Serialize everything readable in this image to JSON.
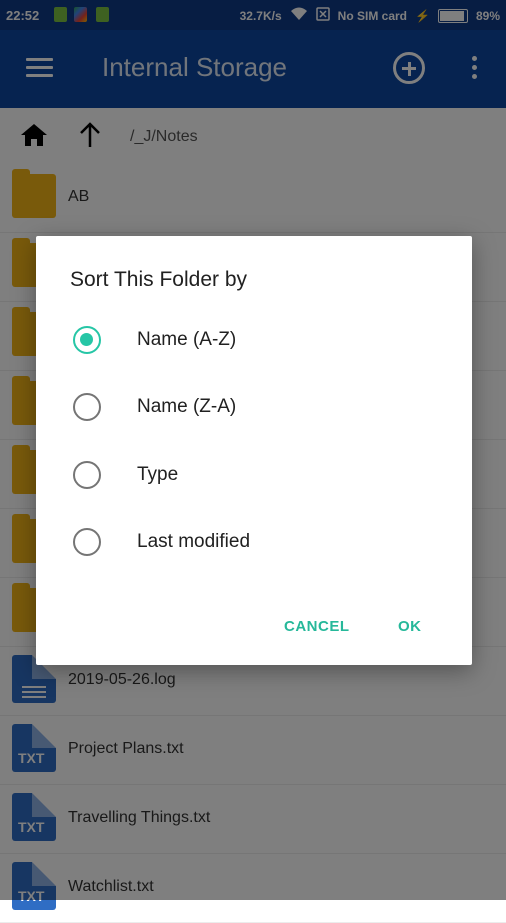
{
  "status_bar": {
    "time": "22:52",
    "speed": "32.7K/s",
    "sim": "No SIM card",
    "battery": "89%",
    "battery_level": 0.89
  },
  "app_bar": {
    "title": "Internal Storage"
  },
  "path_bar": {
    "path": "/_J/Notes"
  },
  "files": [
    {
      "name": "AB",
      "icon": "folder-icon"
    },
    {
      "name": "",
      "icon": "folder-icon"
    },
    {
      "name": "",
      "icon": "folder-icon"
    },
    {
      "name": "",
      "icon": "folder-icon"
    },
    {
      "name": "",
      "icon": "folder-icon"
    },
    {
      "name": "",
      "icon": "folder-icon"
    },
    {
      "name": "",
      "icon": "folder-icon"
    },
    {
      "name": "2019-05-26.log",
      "icon": "log-file-icon"
    },
    {
      "name": "Project Plans.txt",
      "icon": "txt-file-icon",
      "tag": "TXT"
    },
    {
      "name": "Travelling Things.txt",
      "icon": "txt-file-icon",
      "tag": "TXT"
    },
    {
      "name": "Watchlist.txt",
      "icon": "txt-file-icon",
      "tag": "TXT"
    }
  ],
  "dialog": {
    "title": "Sort This Folder by",
    "options": [
      {
        "label": "Name (A-Z)",
        "selected": true
      },
      {
        "label": "Name (Z-A)",
        "selected": false
      },
      {
        "label": "Type",
        "selected": false
      },
      {
        "label": "Last modified",
        "selected": false
      }
    ],
    "cancel_label": "CANCEL",
    "ok_label": "OK"
  },
  "colors": {
    "app_bar": "#0d47a1",
    "status_bar": "#0f3a86",
    "accent": "#26c6a6",
    "folder": "#f2b517",
    "file": "#2f6dc4"
  }
}
